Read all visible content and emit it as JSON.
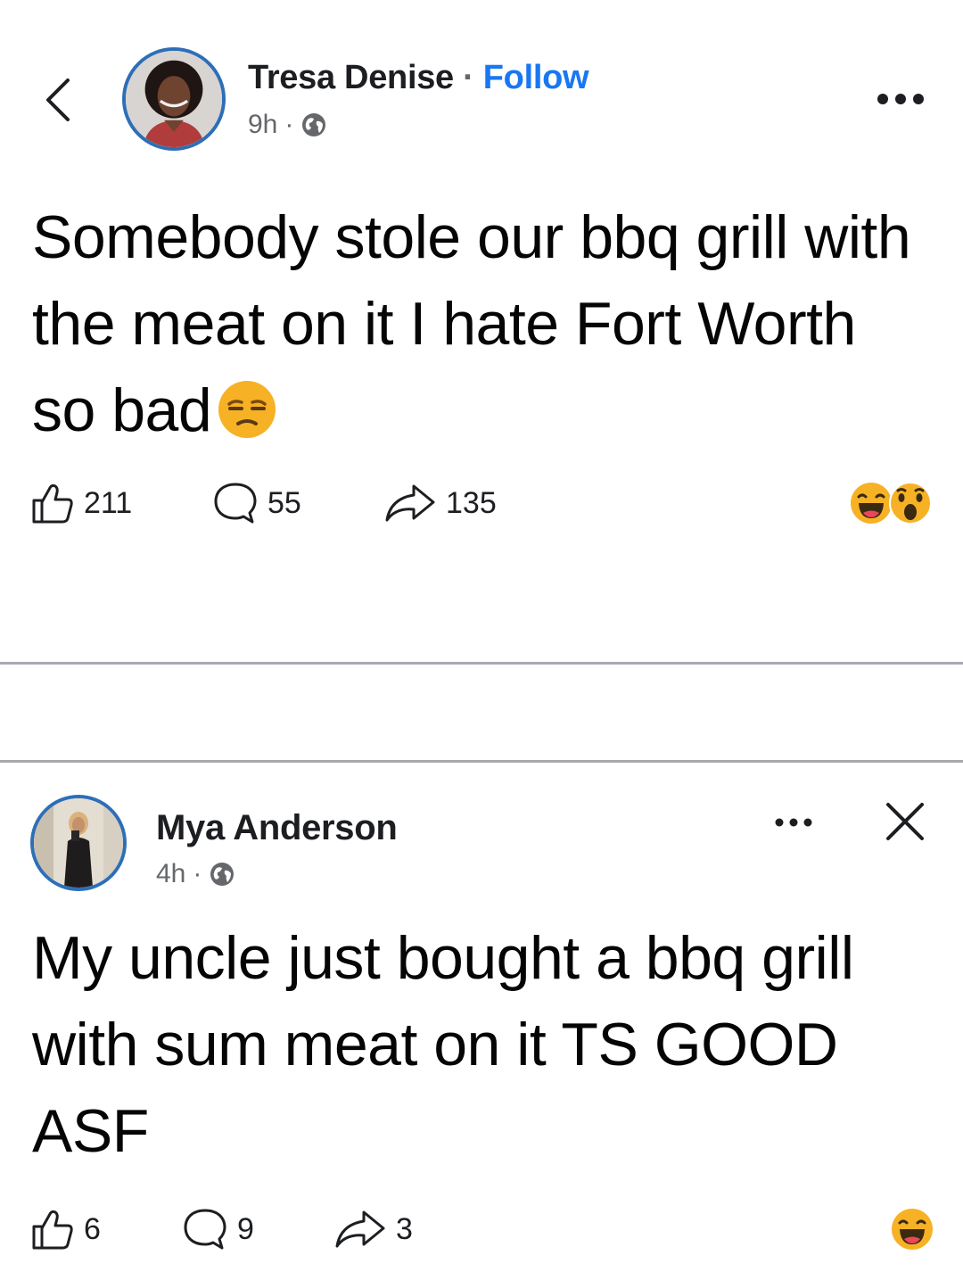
{
  "post1": {
    "author": "Tresa Denise",
    "separator": " · ",
    "follow_label": "Follow",
    "time": "9h",
    "meta_dot": "·",
    "audience_icon": "globe-icon",
    "text": "Somebody stole our bbq grill with the meat on it I hate Fort Worth so bad",
    "text_emoji": "unamused-face-emoji",
    "likes": "211",
    "comments": "55",
    "shares": "135",
    "reactions": [
      "haha",
      "wow"
    ]
  },
  "post2": {
    "author": "Mya Anderson",
    "time": "4h",
    "meta_dot": "·",
    "audience_icon": "globe-icon",
    "text": "My uncle just bought a bbq grill with sum meat on it TS GOOD ASF",
    "likes": "6",
    "comments": "9",
    "shares": "3",
    "reactions": [
      "haha"
    ]
  },
  "colors": {
    "link": "#1877f2",
    "avatar_ring": "#2d6fb7",
    "muted": "#65676b",
    "divider": "#a7aaad",
    "reaction_yellow": "#f7b125"
  }
}
